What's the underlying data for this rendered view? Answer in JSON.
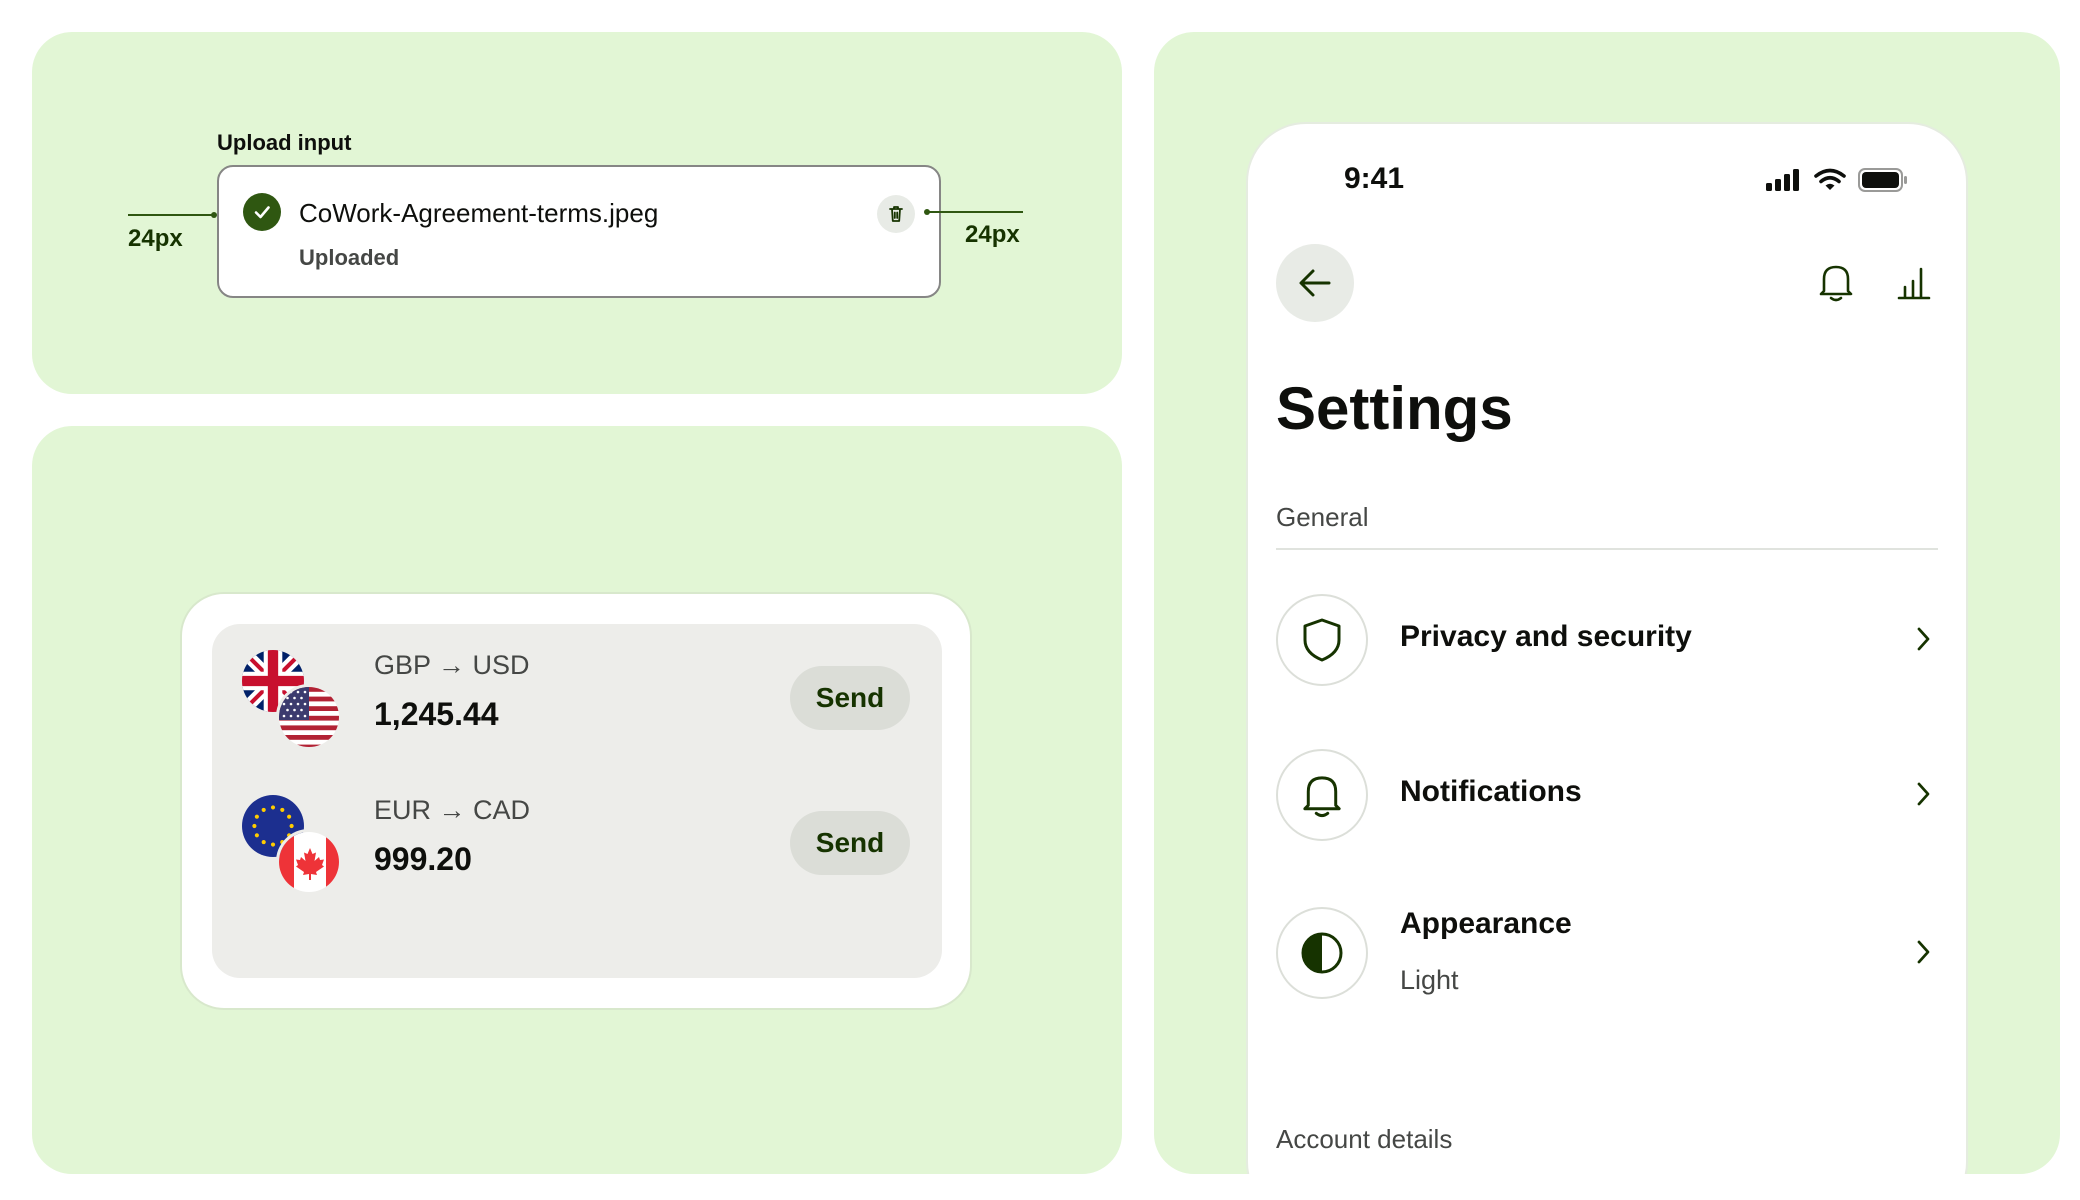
{
  "upload": {
    "title": "Upload input",
    "file_name": "CoWork-Agreement-terms.jpeg",
    "status": "Uploaded",
    "left_spacing": "24px",
    "right_spacing": "24px"
  },
  "fx": {
    "rows": [
      {
        "pair": "GBP → USD",
        "amount": "1,245.44",
        "send_label": "Send",
        "flags": [
          "uk-flag-icon",
          "us-flag-icon"
        ]
      },
      {
        "pair": "EUR → CAD",
        "amount": "999.20",
        "send_label": "Send",
        "flags": [
          "eu-flag-icon",
          "canada-flag-icon"
        ]
      }
    ]
  },
  "settings": {
    "status_time": "9:41",
    "title": "Settings",
    "sections": {
      "general": "General",
      "account": "Account details"
    },
    "items": [
      {
        "label": "Privacy and security",
        "icon": "shield-icon"
      },
      {
        "label": "Notifications",
        "icon": "bell-icon"
      },
      {
        "label": "Appearance",
        "sub": "Light",
        "icon": "contrast-icon"
      }
    ]
  },
  "colors": {
    "panel_bg": "#e2f6d5",
    "forest_green": "#163300",
    "accent_green": "#2f5711"
  }
}
